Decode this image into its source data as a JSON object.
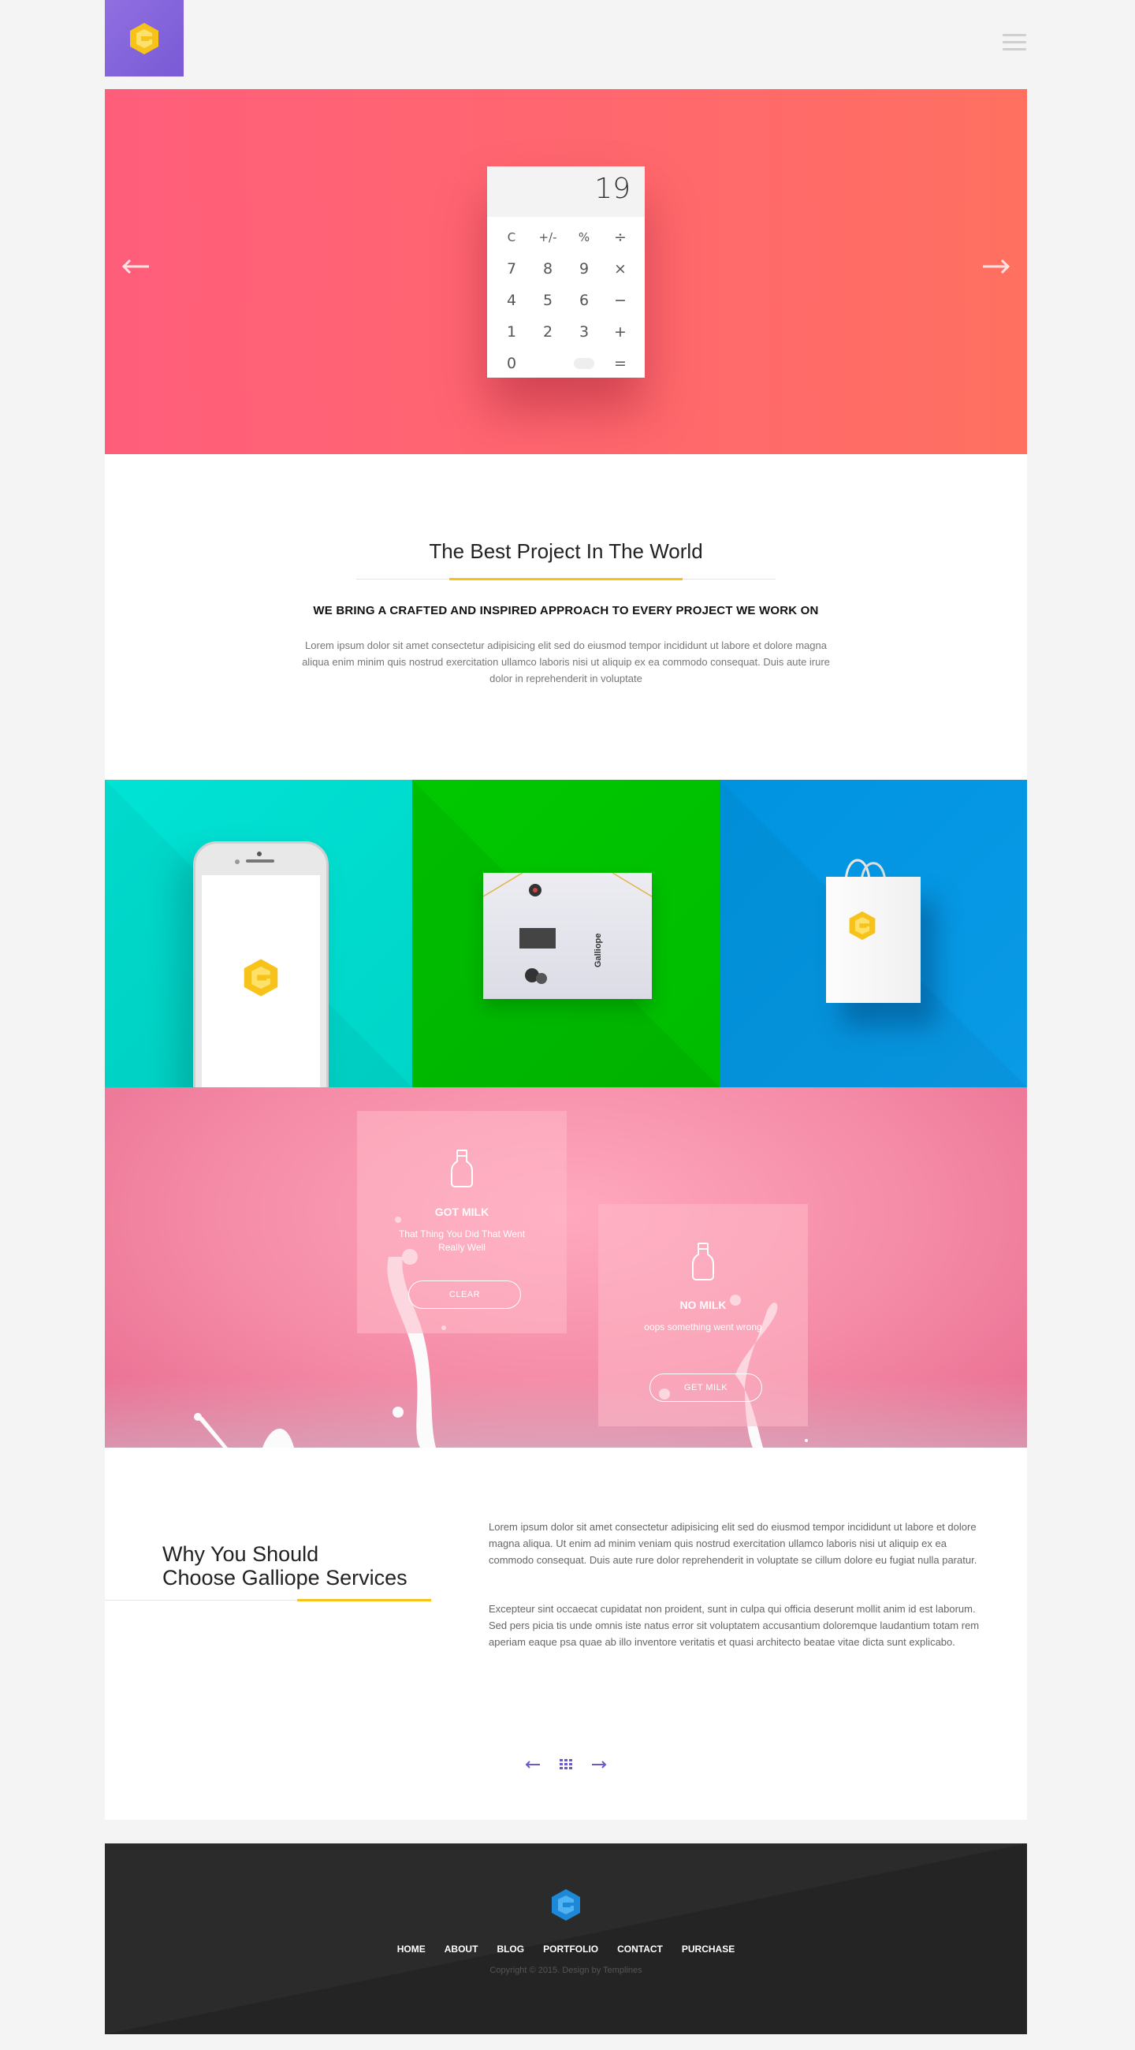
{
  "header": {
    "menu_icon": "hamburger-menu-icon",
    "logo_icon": "galliope-g-logo"
  },
  "colors": {
    "accent_yellow": "#f7c21a",
    "brand_purple": "#7a5ad6",
    "hero_pink": "#ff5e7b",
    "tile_cyan": "#00e3d5",
    "tile_green": "#00c800",
    "tile_blue": "#0094e0",
    "footer_dark": "#2b2b2b"
  },
  "hero": {
    "calculator": {
      "display": "19",
      "keys": [
        "C",
        "+/-",
        "%",
        "÷",
        "7",
        "8",
        "9",
        "×",
        "4",
        "5",
        "6",
        "−",
        "1",
        "2",
        "3",
        "+",
        "0",
        "",
        "",
        "="
      ]
    }
  },
  "intro": {
    "title": "The Best Project In The World",
    "subtitle": "WE BRING A CRAFTED AND INSPIRED APPROACH TO EVERY PROJECT WE WORK ON",
    "body": "Lorem ipsum dolor sit amet consectetur adipisicing elit sed do eiusmod tempor incididunt ut labore et dolore magna aliqua enim minim quis nostrud exercitation ullamco laboris nisi ut aliquip ex ea commodo consequat. Duis aute irure dolor in reprehenderit in voluptate"
  },
  "tiles": {
    "envelope_brand": "Galliope"
  },
  "milk": {
    "card1": {
      "title": "GOT MILK",
      "desc": "That Thing You Did That Went Really Well",
      "button": "CLEAR"
    },
    "card2": {
      "title": "NO MILK",
      "desc": "oops something went wrong",
      "button": "GET MILK"
    }
  },
  "why": {
    "title_line1": "Why You Should",
    "title_line2": "Choose Galliope Services",
    "p1": "Lorem ipsum dolor sit amet consectetur adipisicing elit sed do eiusmod tempor incididunt ut labore et dolore magna aliqua. Ut enim ad minim veniam quis nostrud exercitation ullamco laboris nisi ut aliquip ex ea commodo consequat. Duis aute rure dolor reprehenderit in voluptate se cillum dolore eu fugiat nulla paratur.",
    "p2": "Excepteur sint occaecat cupidatat non proident, sunt in culpa qui officia deserunt mollit anim id est laborum. Sed pers picia tis unde omnis iste natus error sit voluptatem accusantium doloremque laudantium totam rem aperiam eaque psa quae ab illo inventore veritatis et quasi architecto beatae vitae dicta sunt explicabo."
  },
  "footer": {
    "nav": [
      "HOME",
      "ABOUT",
      "BLOG",
      "PORTFOLIO",
      "CONTACT",
      "PURCHASE"
    ],
    "copyright": "Copyright © 2015. Design by Templines"
  }
}
